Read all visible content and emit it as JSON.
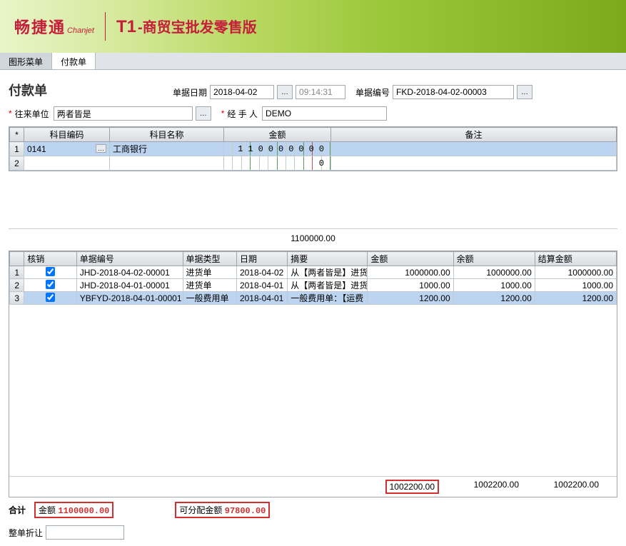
{
  "banner": {
    "logo_cn": "畅捷通",
    "logo_en": "Chanjet",
    "t1": "T1",
    "sub": "-商贸宝批发零售版"
  },
  "tabs": {
    "t0": "图形菜单",
    "t1": "付款单"
  },
  "title": "付款单",
  "header": {
    "date_lbl": "单据日期",
    "date_val": "2018-04-02",
    "time_val": "09:14:31",
    "doc_lbl": "单据编号",
    "doc_val": "FKD-2018-04-02-00003"
  },
  "fields": {
    "party_lbl": "往来单位",
    "party_val": "两者皆是",
    "handler_lbl": "经 手 人",
    "handler_val": "DEMO"
  },
  "grid1": {
    "h0": "*",
    "h1": "科目编码",
    "h2": "科目名称",
    "h3": "金额",
    "h4": "备注",
    "r1_code": "0141",
    "r1_name": "工商银行",
    "r1_amt": "110000000",
    "r2_amt": "0"
  },
  "mid_total": "1100000.00",
  "grid2": {
    "h0": "",
    "h1": "核销",
    "h2": "单据编号",
    "h3": "单据类型",
    "h4": "日期",
    "h5": "摘要",
    "h6": "金额",
    "h7": "余额",
    "h8": "结算金额",
    "rows": [
      {
        "no": "1",
        "doc": "JHD-2018-04-02-00001",
        "type": "进货单",
        "date": "2018-04-02",
        "sum": "从【两者皆是】进货",
        "amt": "1000000.00",
        "bal": "1000000.00",
        "set": "1000000.00",
        "chk": true
      },
      {
        "no": "2",
        "doc": "JHD-2018-04-01-00001",
        "type": "进货单",
        "date": "2018-04-01",
        "sum": "从【两者皆是】进货",
        "amt": "1000.00",
        "bal": "1000.00",
        "set": "1000.00",
        "chk": true
      },
      {
        "no": "3",
        "doc": "YBFYD-2018-04-01-00001",
        "type": "一般费用单",
        "date": "2018-04-01",
        "sum": "一般费用单：【运费",
        "amt": "1200.00",
        "bal": "1200.00",
        "set": "1200.00",
        "chk": true
      }
    ]
  },
  "footer_totals": {
    "c1": "1002200.00",
    "c2": "1002200.00",
    "c3": "1002200.00"
  },
  "totals": {
    "hj": "合计",
    "amt_lbl": "金额",
    "amt_val": "1100000.00",
    "alloc_lbl": "可分配金额",
    "alloc_val": "97800.00"
  },
  "discount_lbl": "整单折让"
}
